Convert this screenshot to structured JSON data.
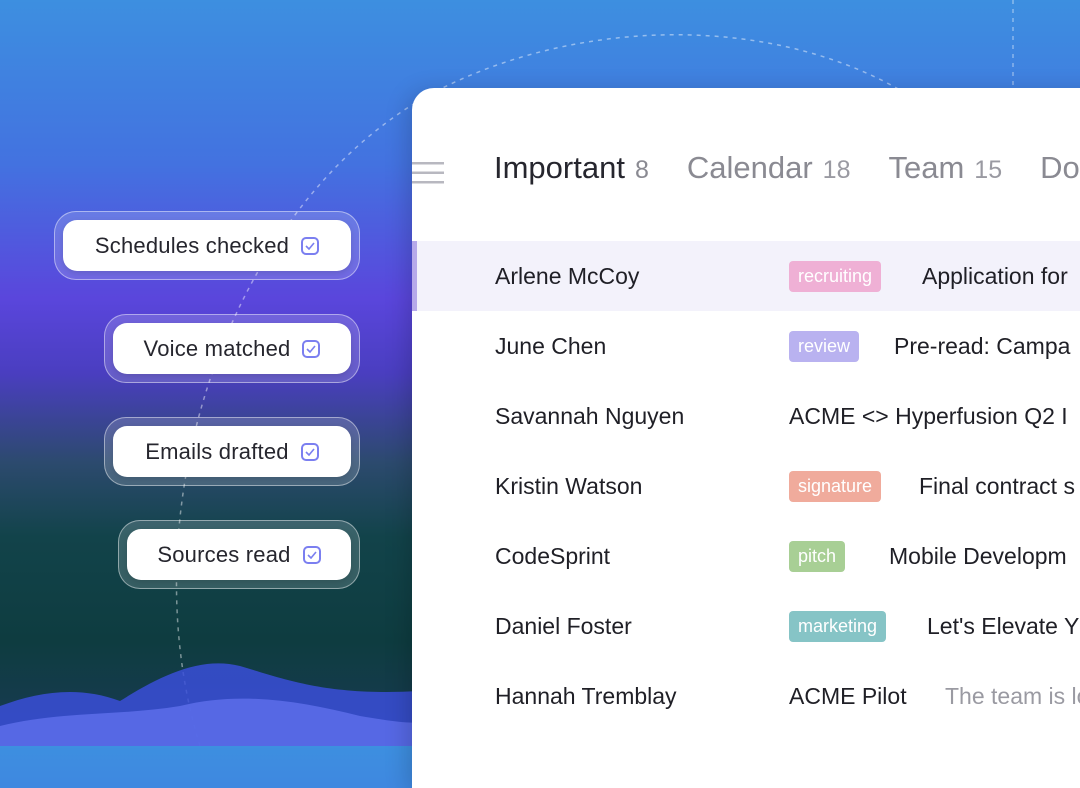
{
  "chips": [
    {
      "label": "Schedules checked",
      "icon": "checkbox-checked-icon"
    },
    {
      "label": "Voice matched",
      "icon": "checkbox-checked-icon"
    },
    {
      "label": "Emails drafted",
      "icon": "checkbox-checked-icon"
    },
    {
      "label": "Sources read",
      "icon": "checkbox-checked-icon"
    }
  ],
  "tabs": [
    {
      "label": "Important",
      "count": "8",
      "active": true
    },
    {
      "label": "Calendar",
      "count": "18",
      "active": false
    },
    {
      "label": "Team",
      "count": "15",
      "active": false
    },
    {
      "label": "Do",
      "count": "",
      "active": false
    }
  ],
  "rows": [
    {
      "name": "Arlene McCoy",
      "tag": "recruiting",
      "tag_color": "#efb0d5",
      "subject": "Application for",
      "preview": "",
      "selected": true
    },
    {
      "name": "June Chen",
      "tag": "review",
      "tag_color": "#b9b2f0",
      "subject": "Pre-read: Campa",
      "preview": "",
      "selected": false
    },
    {
      "name": "Savannah Nguyen",
      "tag": "",
      "tag_color": "",
      "subject": "ACME <> Hyperfusion Q2 I",
      "preview": "",
      "selected": false
    },
    {
      "name": "Kristin Watson",
      "tag": "signature",
      "tag_color": "#f0ab9c",
      "subject": "Final contract s",
      "preview": "",
      "selected": false
    },
    {
      "name": "CodeSprint",
      "tag": "pitch",
      "tag_color": "#a8cf95",
      "subject": "Mobile Developm",
      "preview": "",
      "selected": false
    },
    {
      "name": "Daniel Foster",
      "tag": "marketing",
      "tag_color": "#86c4c6",
      "subject": "Let's Elevate Y",
      "preview": "",
      "selected": false
    },
    {
      "name": "Hannah Tremblay",
      "tag": "",
      "tag_color": "",
      "subject": "ACME Pilot",
      "preview": "The team is lo",
      "selected": false
    }
  ],
  "colors": {
    "accent": "#b6a9ea",
    "selected_row": "#f3f2fb",
    "checkbox": "#7b7ff0"
  }
}
